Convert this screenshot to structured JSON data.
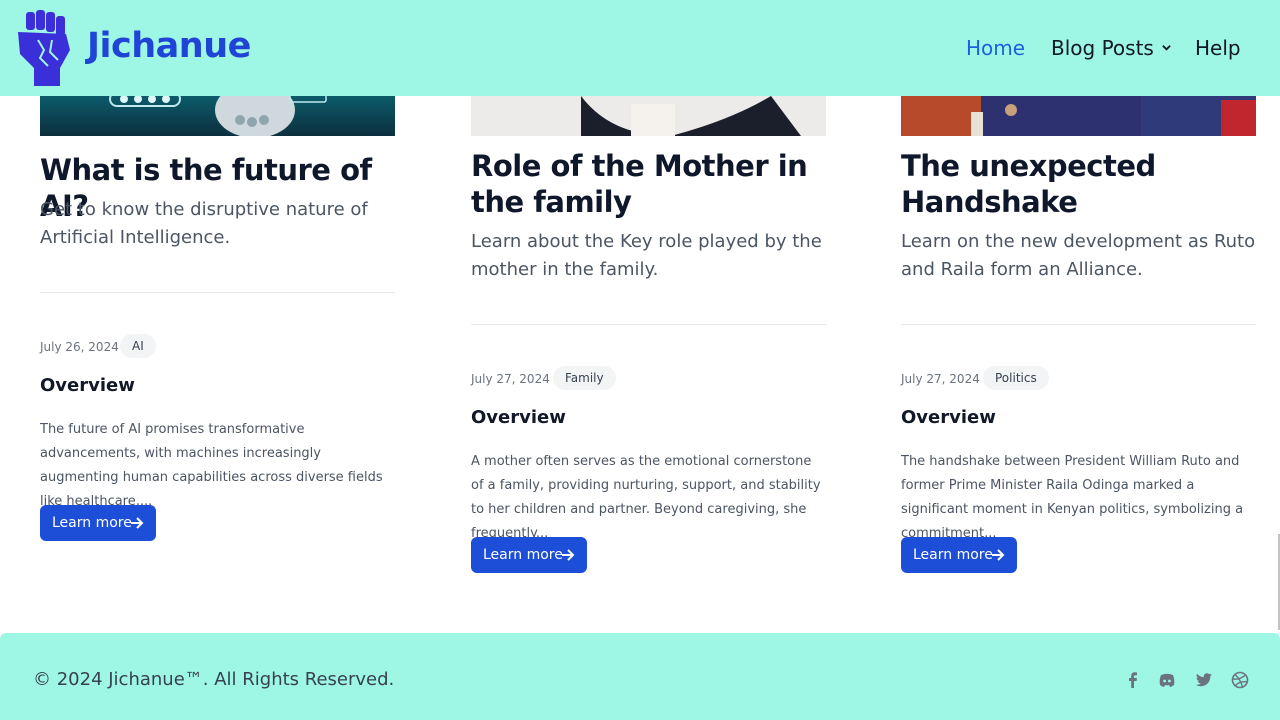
{
  "header": {
    "brand": "Jichanue",
    "nav": {
      "home": "Home",
      "blog_posts": "Blog Posts",
      "help": "Help"
    },
    "brand_color": "#1f44d6",
    "bg_color": "#9ef6e5"
  },
  "cards": [
    {
      "title": "What is the future of AI?",
      "subtitle": "Get to know the disruptive nature of Artificial Intelligence.",
      "date": "July 26, 2024",
      "tag": "AI",
      "overview_heading": "Overview",
      "excerpt": "The future of AI promises transformative advancements, with machines increasingly augmenting human capabilities across diverse fields like healthcare,...",
      "button": "Learn more"
    },
    {
      "title": "Role of the Mother in the family",
      "subtitle": "Learn about the Key role played by the mother in the family.",
      "date": "July 27, 2024",
      "tag": "Family",
      "overview_heading": "Overview",
      "excerpt": "A mother often serves as the emotional cornerstone of a family, providing nurturing, support, and stability to her children and partner. Beyond caregiving, she frequently...",
      "button": "Learn more"
    },
    {
      "title": "The unexpected Handshake",
      "subtitle": "Learn on the new development as Ruto and Raila form an Alliance.",
      "date": "July 27, 2024",
      "tag": "Politics",
      "overview_heading": "Overview",
      "excerpt": "The handshake between President William Ruto and former Prime Minister Raila Odinga marked a significant moment in Kenyan politics, symbolizing a commitment...",
      "button": "Learn more"
    }
  ],
  "footer": {
    "copyright": "© 2024 Jichanue™. All Rights Reserved.",
    "social_icons": [
      "facebook-icon",
      "discord-icon",
      "twitter-icon",
      "dribbble-icon"
    ]
  },
  "button_color": "#1d4ed8"
}
